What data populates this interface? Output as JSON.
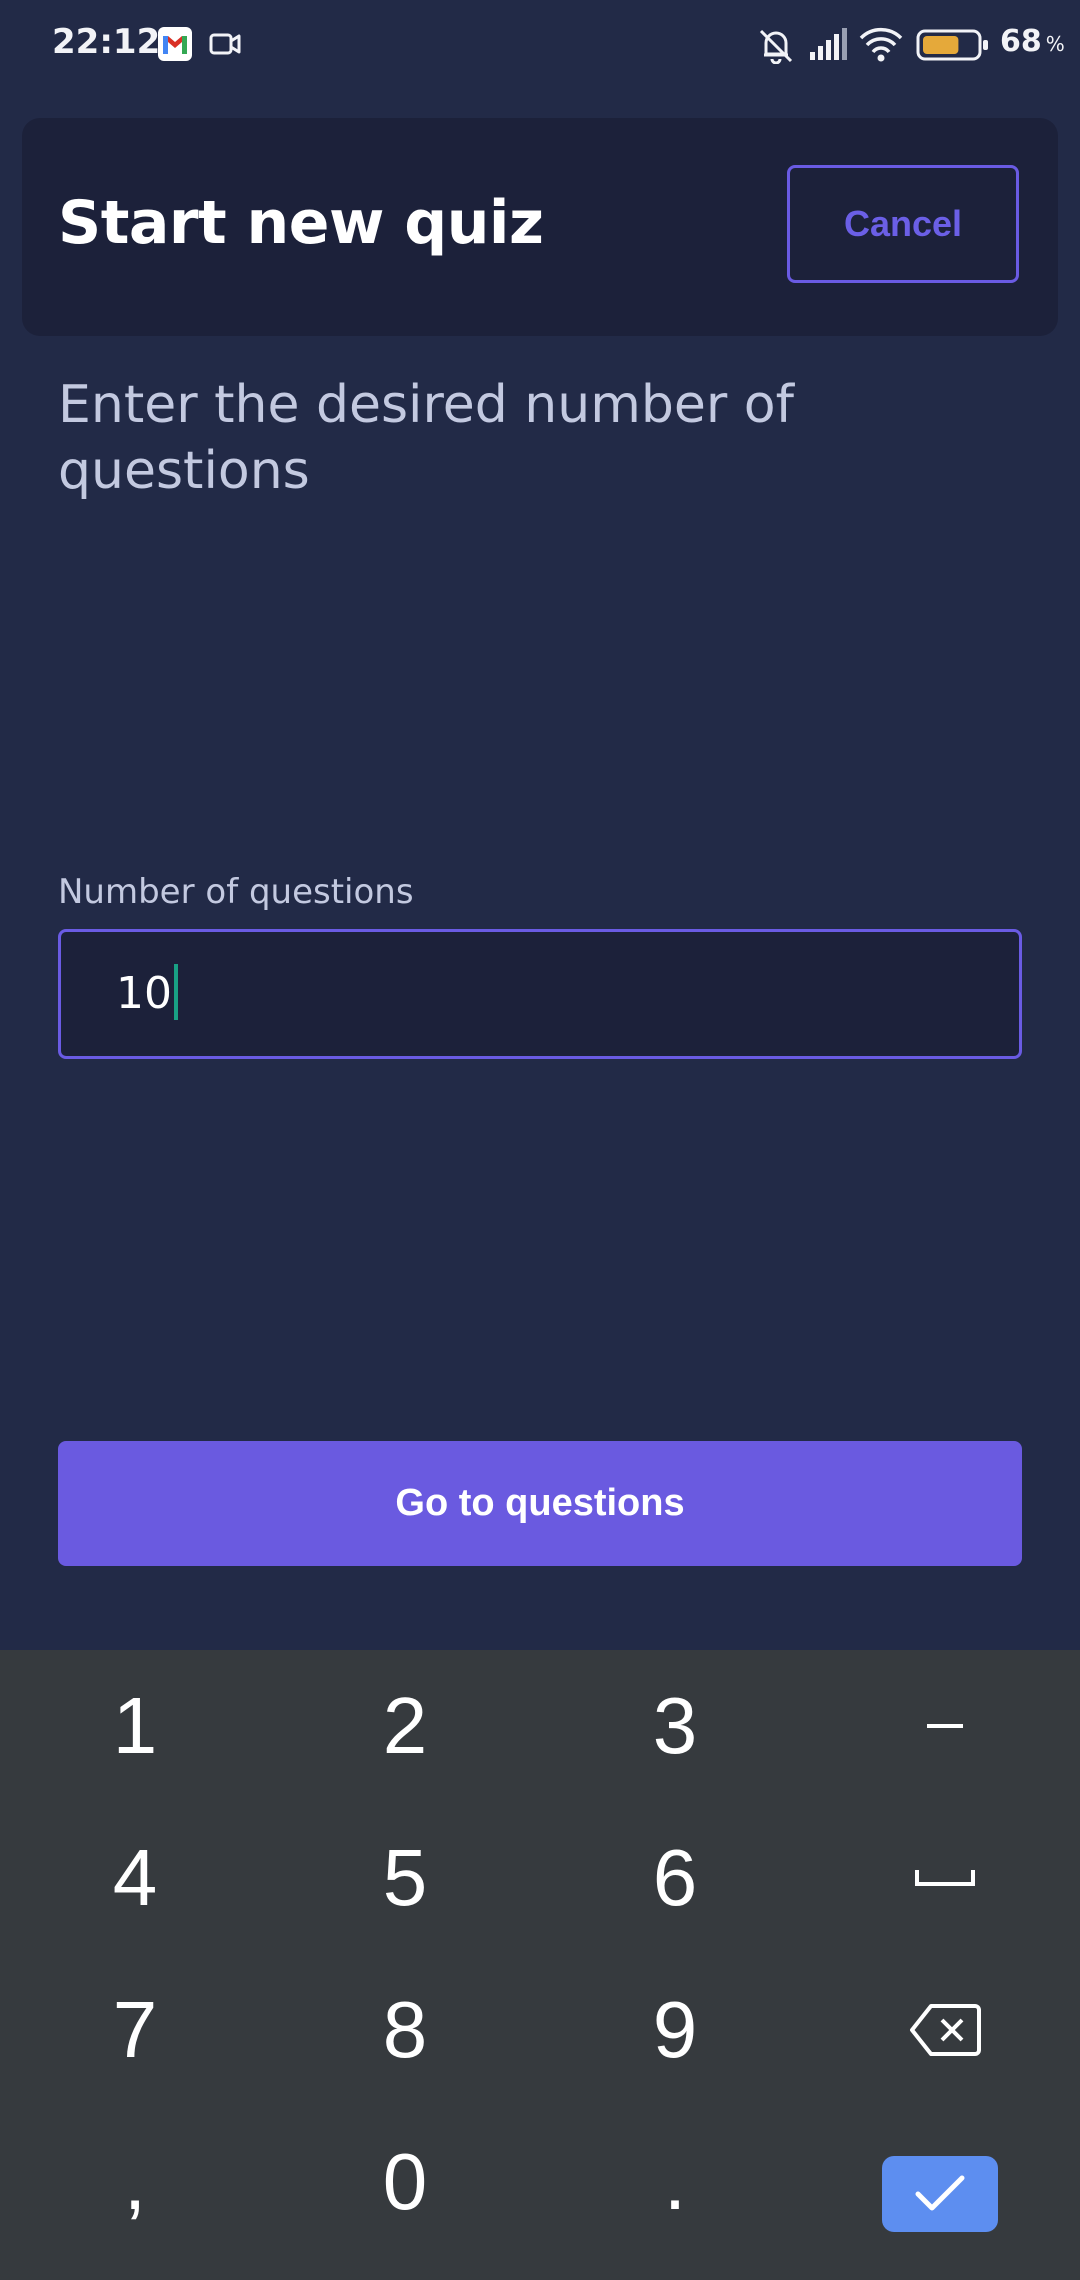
{
  "status_bar": {
    "time": "22:12",
    "battery_percent": "68",
    "battery_unit": "%",
    "battery_level": 0.68,
    "icons": [
      "gmail-icon",
      "video-camera-icon",
      "notifications-muted-icon",
      "signal-icon",
      "wifi-icon",
      "battery-icon"
    ]
  },
  "header": {
    "title": "Start new quiz",
    "cancel_label": "Cancel"
  },
  "instruction": "Enter the desired number of questions",
  "form": {
    "label": "Number of questions",
    "value": "10"
  },
  "submit_label": "Go to questions",
  "keyboard": {
    "keys": [
      [
        "1",
        "2",
        "3",
        "−"
      ],
      [
        "4",
        "5",
        "6",
        "space"
      ],
      [
        "7",
        "8",
        "9",
        "backspace"
      ],
      [
        ",",
        "0",
        ".",
        "done"
      ]
    ]
  },
  "colors": {
    "background": "#222a47",
    "card": "#1c213a",
    "accent": "#6a5ae0",
    "muted_text": "#c3c9e0",
    "caret": "#19a185",
    "keyboard_bg": "#363a3e",
    "done_key": "#5d8ef0"
  }
}
